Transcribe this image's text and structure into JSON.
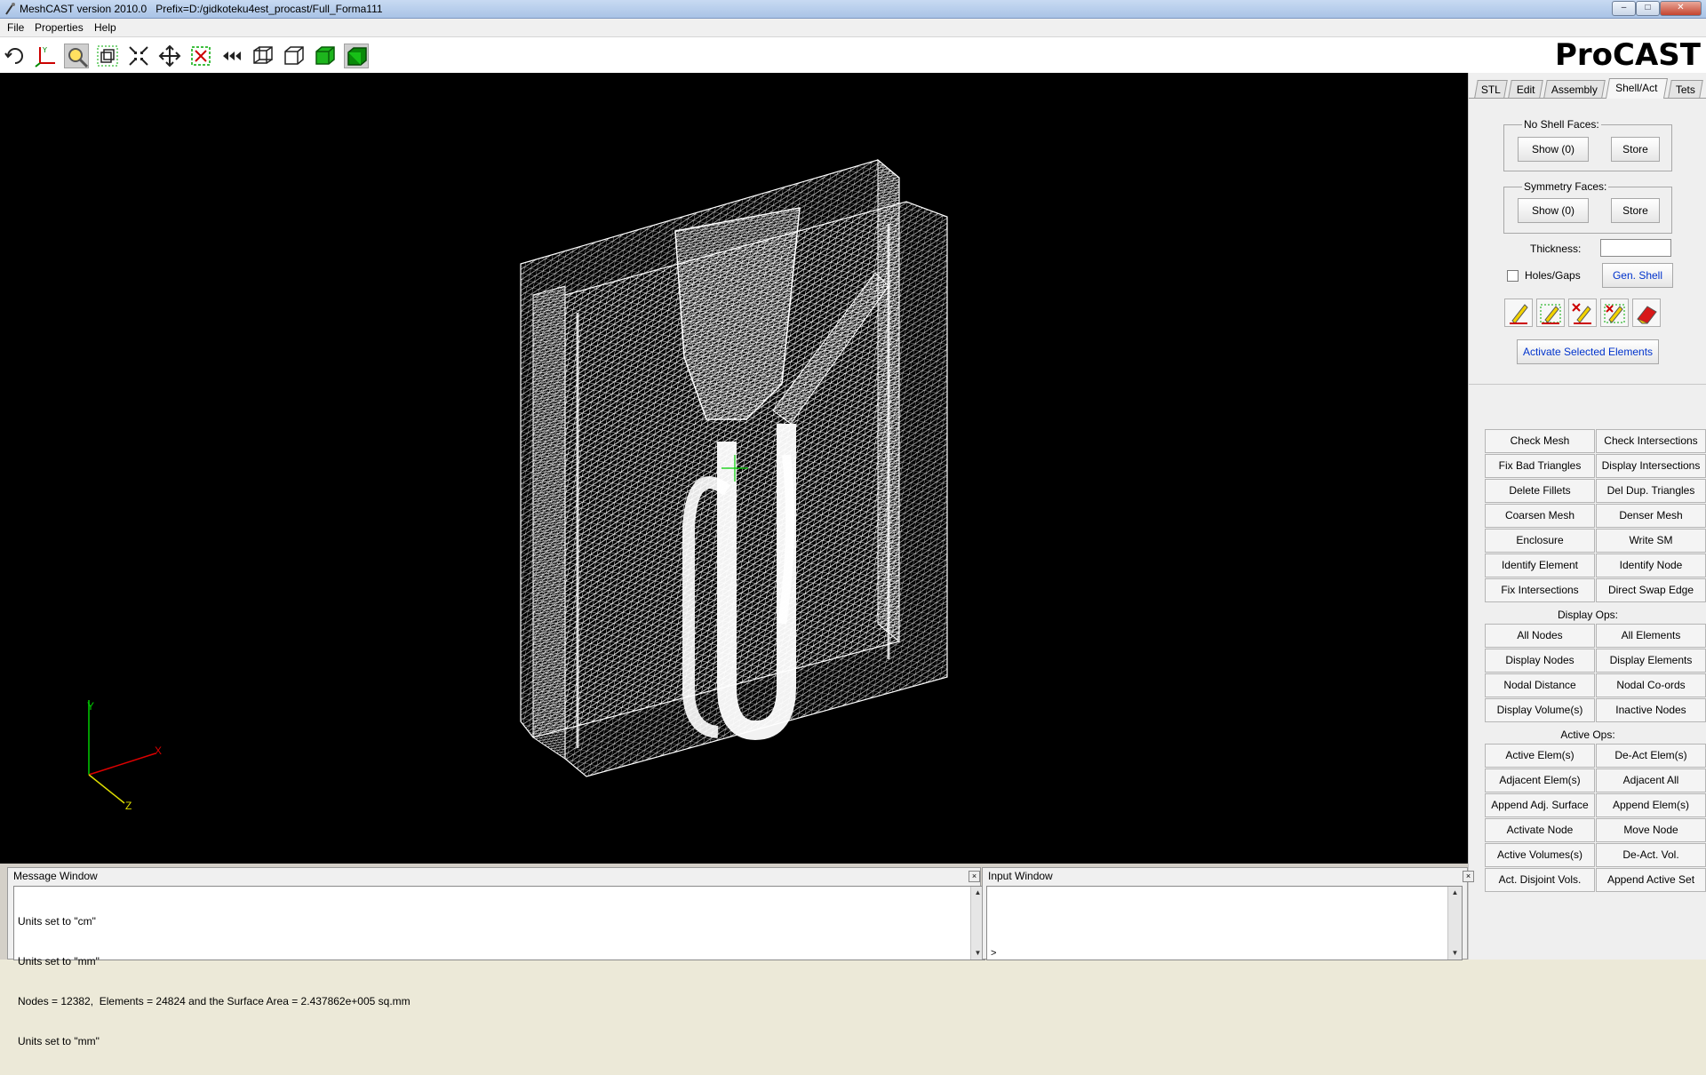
{
  "window": {
    "title": "MeshCAST version 2010.0   Prefix=D:/gidkoteku4est_procast/Full_Forma111",
    "minimize_label": "–",
    "maximize_label": "□",
    "close_label": "✕"
  },
  "menu": {
    "file": "File",
    "properties": "Properties",
    "help": "Help"
  },
  "toolbar": {
    "icons": [
      "rotate-icon",
      "axis-icon",
      "zoom-icon",
      "zoom-box-icon",
      "fit-icon",
      "pan-icon",
      "select-icon",
      "back-icon",
      "wireframe-icon",
      "box-icon",
      "solid-green-icon",
      "shaded-green-icon"
    ]
  },
  "logo": {
    "text": "ProCAST"
  },
  "tabs": [
    {
      "label": "STL"
    },
    {
      "label": "Edit"
    },
    {
      "label": "Assembly"
    },
    {
      "label": "Shell/Act"
    },
    {
      "label": "Tets"
    }
  ],
  "active_tab": "Shell/Act",
  "shell": {
    "no_shell_faces_label": "No Shell Faces:",
    "show_label": "Show (0)",
    "store_label": "Store",
    "symmetry_faces_label": "Symmetry Faces:",
    "sym_show_label": "Show (0)",
    "sym_store_label": "Store",
    "thickness_label": "Thickness:",
    "thickness_value": "",
    "holes_label": "Holes/Gaps",
    "holes_checked": false,
    "gen_shell_label": "Gen. Shell",
    "activate_selected_label": "Activate Selected Elements"
  },
  "ops": {
    "general": [
      [
        "Check Mesh",
        "Check Intersections"
      ],
      [
        "Fix Bad Triangles",
        "Display Intersections"
      ],
      [
        "Delete Fillets",
        "Del Dup. Triangles"
      ],
      [
        "Coarsen Mesh",
        "Denser Mesh"
      ],
      [
        "Enclosure",
        "Write SM"
      ],
      [
        "Identify Element",
        "Identify Node"
      ],
      [
        "Fix Intersections",
        "Direct Swap Edge"
      ]
    ],
    "display_label": "Display Ops:",
    "display": [
      [
        "All Nodes",
        "All Elements"
      ],
      [
        "Display Nodes",
        "Display Elements"
      ],
      [
        "Nodal Distance",
        "Nodal Co-ords"
      ],
      [
        "Display Volume(s)",
        "Inactive Nodes"
      ]
    ],
    "active_label": "Active Ops:",
    "active": [
      [
        "Active Elem(s)",
        "De-Act Elem(s)"
      ],
      [
        "Adjacent Elem(s)",
        "Adjacent All"
      ],
      [
        "Append Adj. Surface",
        "Append Elem(s)"
      ],
      [
        "Activate Node",
        "Move Node"
      ],
      [
        "Active Volumes(s)",
        "De-Act. Vol."
      ],
      [
        "Act. Disjoint Vols.",
        "Append Active Set"
      ]
    ]
  },
  "axes": {
    "x": "X",
    "y": "Y",
    "z": "Z"
  },
  "message_window": {
    "title": "Message Window",
    "lines": [
      "Units set to \"cm\"",
      "Units set to \"mm\"",
      "Nodes = 12382,  Elements = 24824 and the Surface Area = 2.437862e+005 sq.mm",
      "Units set to \"mm\""
    ]
  },
  "input_window": {
    "title": "Input Window",
    "prompt": ">"
  },
  "colors": {
    "accent_link": "#0033cc",
    "viewport_bg": "#000000",
    "crosshair": "#00cc00"
  }
}
